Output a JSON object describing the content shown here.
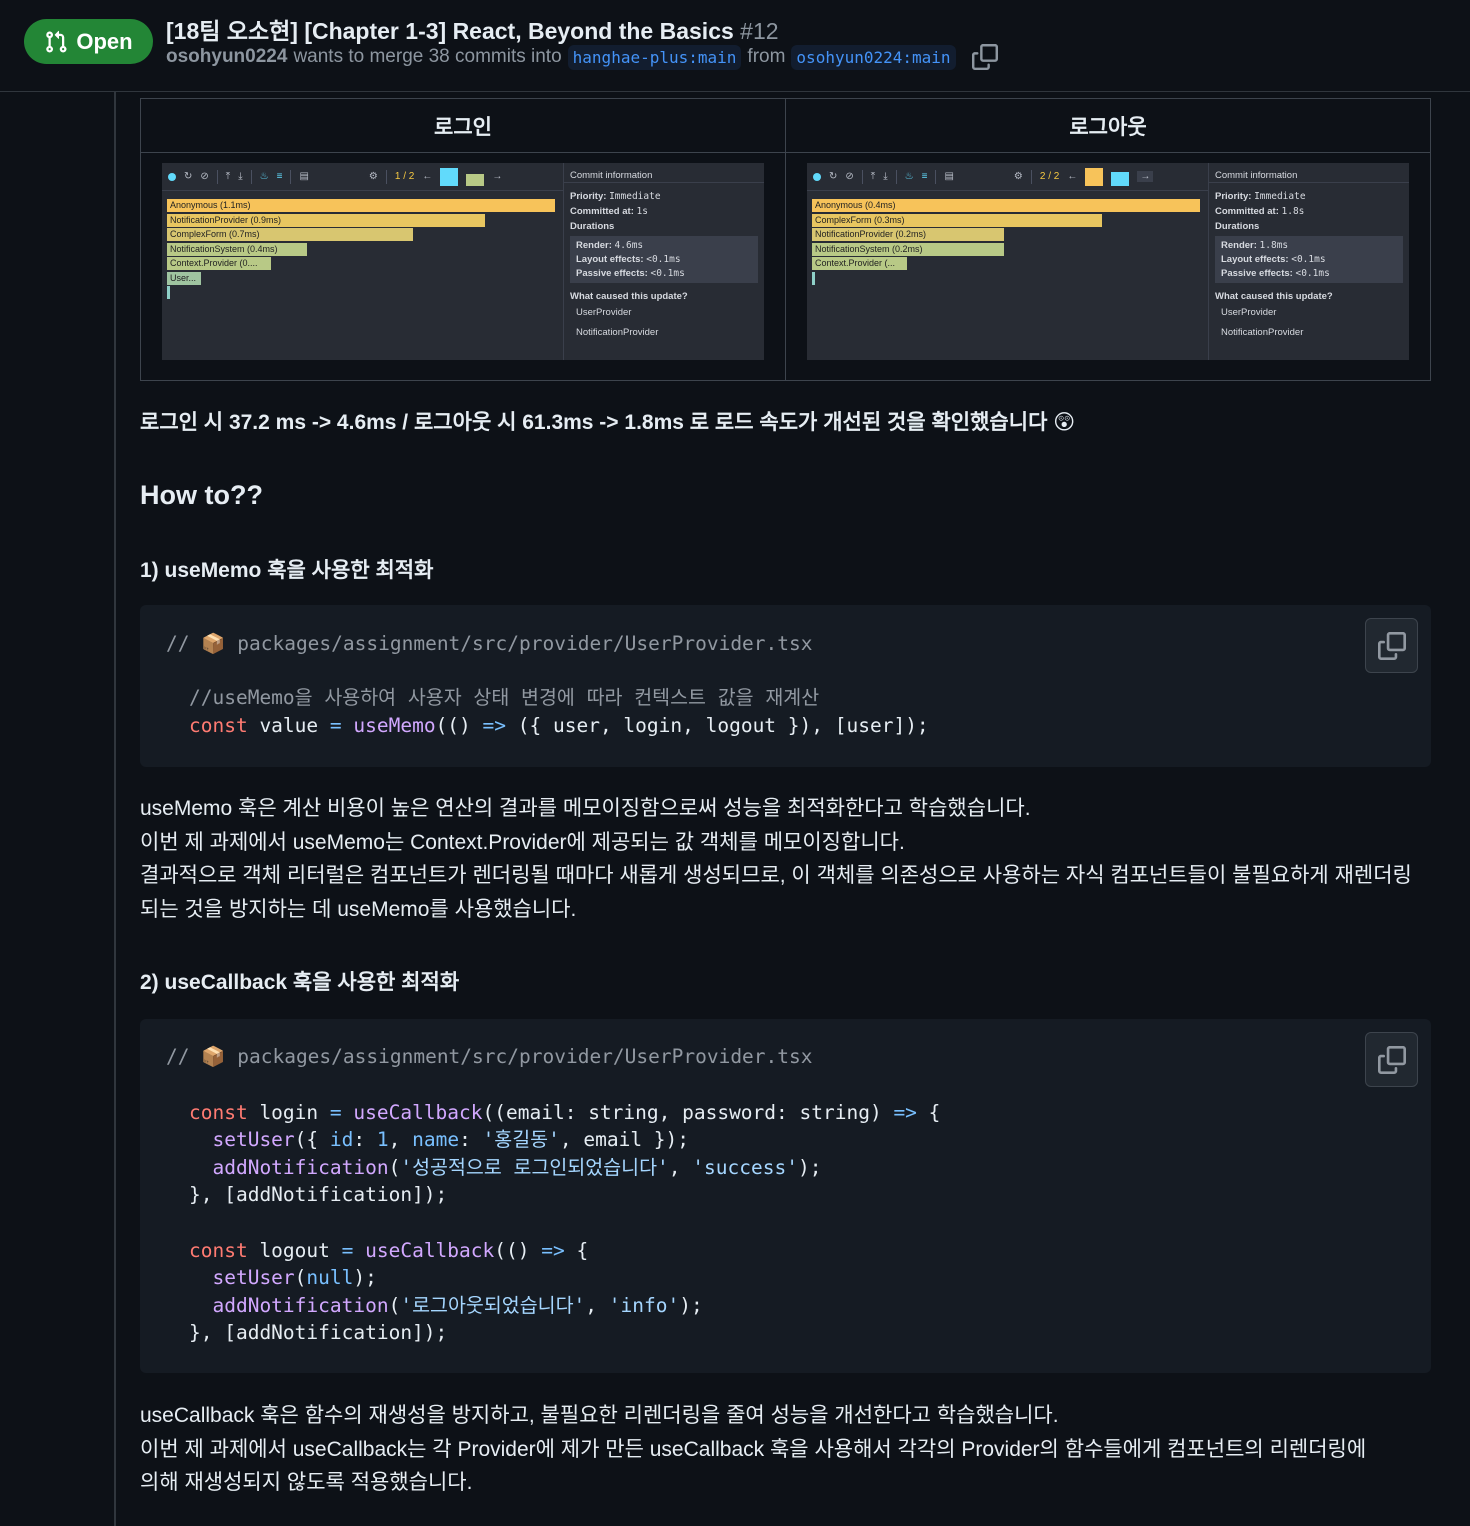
{
  "header": {
    "state": "Open",
    "title": "[18팀 오소현] [Chapter 1-3] React, Beyond the Basics",
    "number": "#12",
    "author": "osohyun0224",
    "merge_text": "wants to merge 38 commits into",
    "base_branch": "hanghae-plus:main",
    "from_text": "from",
    "head_branch": "osohyun0224:main"
  },
  "table": {
    "col1": "로그인",
    "col2": "로그아웃",
    "login_profiler": {
      "page": "1 / 2",
      "commit_info": "Commit information",
      "priority_label": "Priority:",
      "priority": "Immediate",
      "committed_label": "Committed at:",
      "committed": "1s",
      "durations": "Durations",
      "render_label": "Render:",
      "render": "4.6ms",
      "layout_label": "Layout effects:",
      "layout": "<0.1ms",
      "passive_label": "Passive effects:",
      "passive": "<0.1ms",
      "cause": "What caused this update?",
      "cause1": "UserProvider",
      "cause2": "NotificationProvider",
      "bars": [
        "Anonymous (1.1ms)",
        "NotificationProvider (0.9ms)",
        "ComplexForm (0.7ms)",
        "NotificationSystem (0.4ms)",
        "Context.Provider (0....",
        "User..."
      ]
    },
    "logout_profiler": {
      "page": "2 / 2",
      "commit_info": "Commit information",
      "priority_label": "Priority:",
      "priority": "Immediate",
      "committed_label": "Committed at:",
      "committed": "1.8s",
      "durations": "Durations",
      "render_label": "Render:",
      "render": "1.8ms",
      "layout_label": "Layout effects:",
      "layout": "<0.1ms",
      "passive_label": "Passive effects:",
      "passive": "<0.1ms",
      "cause": "What caused this update?",
      "cause1": "UserProvider",
      "cause2": "NotificationProvider",
      "bars": [
        "Anonymous (0.4ms)",
        "ComplexForm (0.3ms)",
        "NotificationProvider (0.2ms)",
        "NotificationSystem (0.2ms)",
        "Context.Provider (..."
      ]
    }
  },
  "result_text": "로그인 시 37.2 ms -> 4.6ms / 로그아웃 시 61.3ms -> 1.8ms 로 로드 속도가 개선된 것을 확인했습니다 😲",
  "how_to": "How to??",
  "section1": {
    "heading": "1) useMemo 훅을 사용한 최적화",
    "code_path": "// 📦 packages/assignment/src/provider/UserProvider.tsx",
    "code_comment": "//useMemo을 사용하여 사용자 상태 변경에 따라 컨텍스트 값을 재계산",
    "code_line": {
      "kw": "const",
      "name": " value ",
      "eq": "=",
      "fn": " useMemo",
      "p1": "(()",
      "arrow": " =>",
      "rest": " ({ user, login, logout }), [user]);"
    },
    "para": [
      "useMemo 훅은 계산 비용이 높은 연산의 결과를 메모이징함으로써 성능을 최적화한다고 학습했습니다.",
      "이번 제 과제에서 useMemo는 Context.Provider에 제공되는 값 객체를 메모이징합니다.",
      "결과적으로 객체 리터럴은 컴포넌트가 렌더링될 때마다 새롭게 생성되므로, 이 객체를 의존성으로 사용하는 자식 컴포넌트들이 불필요하게 재렌더링",
      "되는 것을 방지하는 데 useMemo를 사용했습니다."
    ]
  },
  "section2": {
    "heading": "2) useCallback 훅을 사용한 최적화",
    "code_path": "// 📦 packages/assignment/src/provider/UserProvider.tsx",
    "login": {
      "l1_kw": "const",
      "l1_name": " login ",
      "l1_eq": "=",
      "l1_fn": " useCallback",
      "l1_rest": "((email: string, password: string)",
      "l1_arrow": " =>",
      "l1_end": " {",
      "l2_fn": "  setUser",
      "l2_a": "({ ",
      "l2_k1": "id",
      "l2_b": ": ",
      "l2_n": "1",
      "l2_c": ", ",
      "l2_k2": "name",
      "l2_d": ": ",
      "l2_s": "'홍길동'",
      "l2_e": ", email });",
      "l3_fn": "  addNotification",
      "l3_a": "(",
      "l3_s1": "'성공적으로 로그인되었습니다'",
      "l3_b": ", ",
      "l3_s2": "'success'",
      "l3_c": ");",
      "l4": "}, [addNotification]);"
    },
    "logout": {
      "l1_kw": "const",
      "l1_name": " logout ",
      "l1_eq": "=",
      "l1_fn": " useCallback",
      "l1_rest": "(()",
      "l1_arrow": " =>",
      "l1_end": " {",
      "l2_fn": "  setUser",
      "l2_a": "(",
      "l2_n": "null",
      "l2_b": ");",
      "l3_fn": "  addNotification",
      "l3_a": "(",
      "l3_s1": "'로그아웃되었습니다'",
      "l3_b": ", ",
      "l3_s2": "'info'",
      "l3_c": ");",
      "l4": "}, [addNotification]);"
    },
    "para": [
      "useCallback 훅은 함수의 재생성을 방지하고, 불필요한 리렌더링을 줄여 성능을 개선한다고 학습했습니다.",
      "이번 제 과제에서 useCallback는 각 Provider에 제가 만든 useCallback 훅을 사용해서 각각의 Provider의 함수들에게 컴포넌트의 리렌더링에",
      "의해 재생성되지 않도록 적용했습니다."
    ]
  },
  "colors": {
    "open_badge": "#238636",
    "bar_orange": "#f7c35a",
    "bar_yellow": "#e8c660",
    "bar_green": "#b8c986"
  }
}
